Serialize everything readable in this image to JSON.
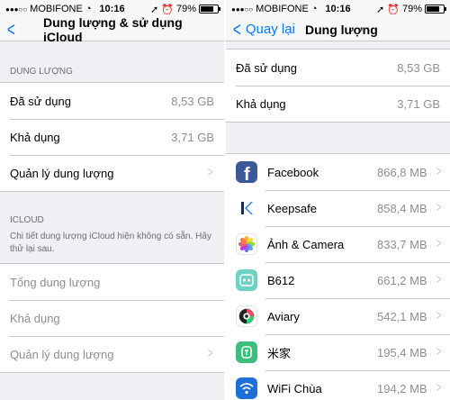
{
  "left": {
    "status": {
      "carrier": "MOBIFONE",
      "time": "10:16",
      "battery_text": "79%",
      "battery_level": 0.79
    },
    "nav": {
      "title": "Dung lượng & sử dụng iCloud"
    },
    "storage_section": {
      "header": "DUNG LƯỢNG",
      "rows": [
        {
          "label": "Đã sử dụng",
          "value": "8,53 GB"
        },
        {
          "label": "Khả dụng",
          "value": "3,71 GB"
        },
        {
          "label": "Quản lý dung lượng"
        }
      ]
    },
    "icloud_section": {
      "header": "ICLOUD",
      "footer": "Chi tiết dung lượng iCloud hiện không có sẵn. Hãy thử lại sau.",
      "rows": [
        {
          "label": "Tổng dung lượng"
        },
        {
          "label": "Khả dụng"
        },
        {
          "label": "Quản lý dung lượng"
        }
      ]
    }
  },
  "right": {
    "status": {
      "carrier": "MOBIFONE",
      "time": "10:16",
      "battery_text": "79%",
      "battery_level": 0.79
    },
    "nav": {
      "back_label": "Quay lại",
      "title": "Dung lượng"
    },
    "summary": [
      {
        "label": "Đã sử dụng",
        "value": "8,53 GB"
      },
      {
        "label": "Khả dụng",
        "value": "3,71 GB"
      }
    ],
    "apps": [
      {
        "name": "Facebook",
        "size": "866,8 MB",
        "icon": "facebook-icon",
        "color": "#3b5998"
      },
      {
        "name": "Keepsafe",
        "size": "858,4 MB",
        "icon": "keepsafe-icon",
        "color": "#ffffff"
      },
      {
        "name": "Ảnh & Camera",
        "size": "833,7 MB",
        "icon": "photos-icon",
        "color": "#ffffff"
      },
      {
        "name": "B612",
        "size": "661,2 MB",
        "icon": "b612-icon",
        "color": "#6fd0c4"
      },
      {
        "name": "Aviary",
        "size": "542,1 MB",
        "icon": "aviary-icon",
        "color": "#ffffff"
      },
      {
        "name": "米家",
        "size": "195,4 MB",
        "icon": "mijia-icon",
        "color": "#3bbf7a"
      },
      {
        "name": "WiFi Chùa",
        "size": "194,2 MB",
        "icon": "wifi-chua-icon",
        "color": "#1e6fd9"
      }
    ]
  }
}
